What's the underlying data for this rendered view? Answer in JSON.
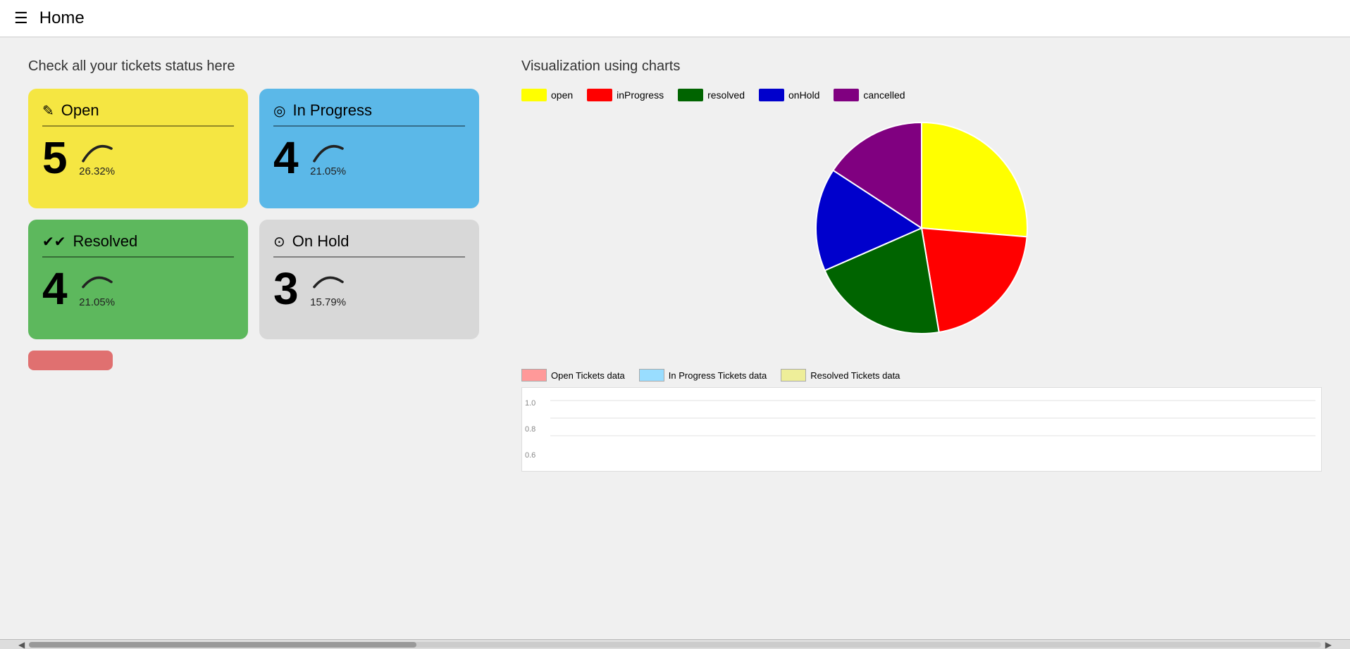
{
  "header": {
    "title": "Home",
    "hamburger_icon": "☰"
  },
  "left_section": {
    "title": "Check all your tickets status here",
    "cards": [
      {
        "id": "open",
        "label": "Open",
        "icon": "✏️",
        "icon_unicode": "✎",
        "count": "5",
        "percent": "26.32%",
        "color": "#f5e642"
      },
      {
        "id": "inprogress",
        "label": "In Progress",
        "icon_unicode": "◎",
        "count": "4",
        "percent": "21.05%",
        "color": "#5bb8e8"
      },
      {
        "id": "resolved",
        "label": "Resolved",
        "icon_unicode": "✓✓",
        "count": "4",
        "percent": "21.05%",
        "color": "#5db85d"
      },
      {
        "id": "onhold",
        "label": "On Hold",
        "icon_unicode": "⊕",
        "count": "3",
        "percent": "15.79%",
        "color": "#d8d8d8"
      }
    ],
    "pink_button_label": ""
  },
  "right_section": {
    "title": "Visualization using charts",
    "pie_legend": [
      {
        "label": "open",
        "color": "#ffff00"
      },
      {
        "label": "inProgress",
        "color": "#ff0000"
      },
      {
        "label": "resolved",
        "color": "#006400"
      },
      {
        "label": "onHold",
        "color": "#0000cc"
      },
      {
        "label": "cancelled",
        "color": "#800080"
      }
    ],
    "pie_data": [
      {
        "label": "open",
        "value": 26.32,
        "color": "#ffff00"
      },
      {
        "label": "inProgress",
        "value": 21.05,
        "color": "#ff0000"
      },
      {
        "label": "resolved",
        "value": 21.05,
        "color": "#006400"
      },
      {
        "label": "onHold",
        "value": 15.79,
        "color": "#0000cc"
      },
      {
        "label": "cancelled",
        "value": 15.79,
        "color": "#800080"
      }
    ],
    "bar_legend": [
      {
        "label": "Open Tickets data",
        "color": "#ff9999"
      },
      {
        "label": "In Progress Tickets data",
        "color": "#99ddff"
      },
      {
        "label": "Resolved Tickets data",
        "color": "#eeee99"
      }
    ],
    "bar_y_labels": [
      "1.0",
      "0.8",
      "0.6"
    ]
  }
}
